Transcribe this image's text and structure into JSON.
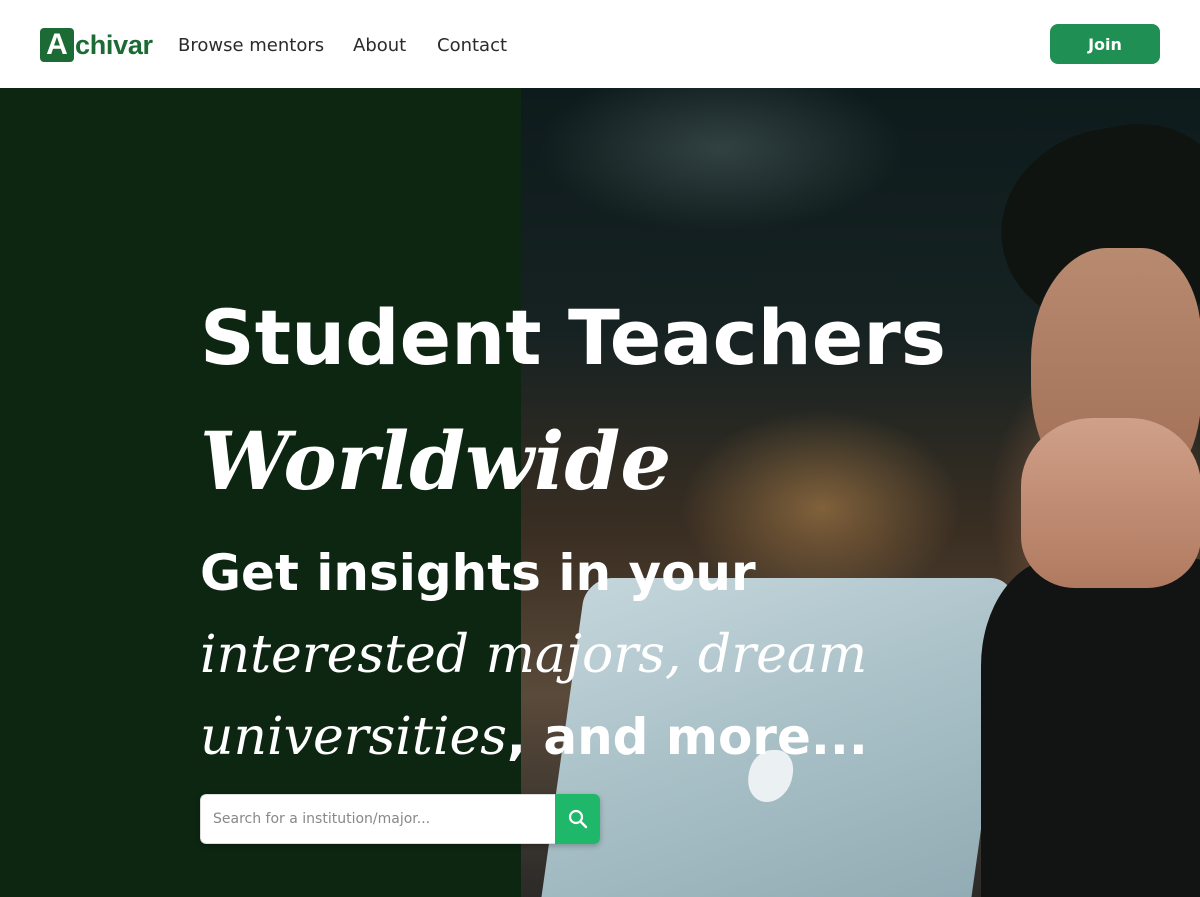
{
  "brand": {
    "logo_letter": "A",
    "logo_rest": "chivar",
    "color": "#1c6b35"
  },
  "nav": {
    "links": [
      "Browse mentors",
      "About",
      "Contact"
    ],
    "join_label": "Join",
    "join_color": "#1f8f54"
  },
  "hero": {
    "title": "Student Teachers",
    "title_italic": "Worldwide",
    "subtitle_part1": "Get insights in your ",
    "subtitle_italic": "interested majors, dream universities",
    "subtitle_part2": ", and more...",
    "bg_left_color": "#0c2612"
  },
  "search": {
    "placeholder": "Search for a institution/major...",
    "value": "",
    "button_icon": "search-icon",
    "button_color": "#1fb86a"
  }
}
